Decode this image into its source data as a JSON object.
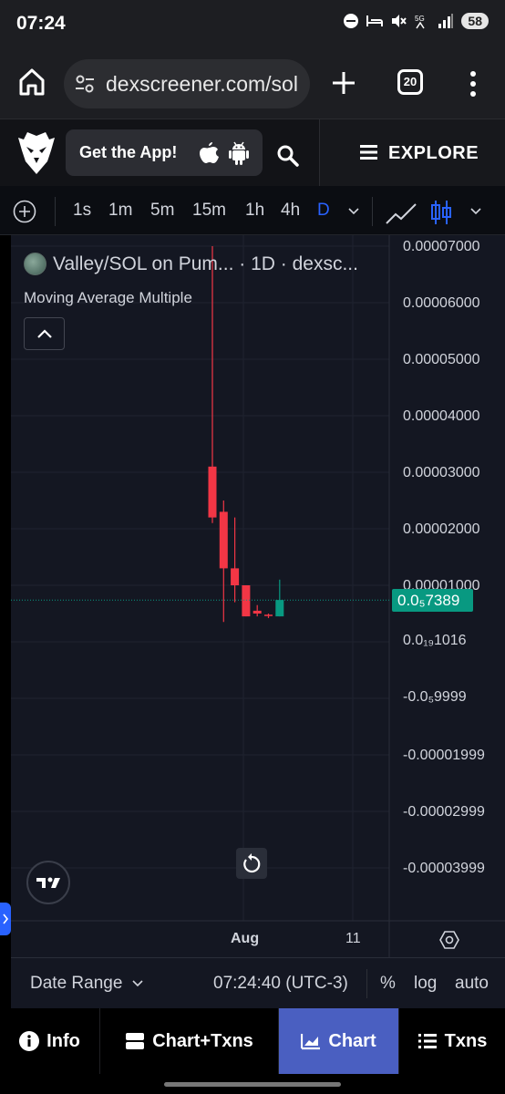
{
  "status": {
    "time": "07:24",
    "battery": "58"
  },
  "browser": {
    "url": "dexscreener.com/sol",
    "tab_count": "20"
  },
  "header": {
    "get_app_label": "Get the App!",
    "explore_label": "EXPLORE"
  },
  "toolbar": {
    "intervals": [
      {
        "label": "1s"
      },
      {
        "label": "1m"
      },
      {
        "label": "5m"
      },
      {
        "label": "15m"
      },
      {
        "label": "1h"
      },
      {
        "label": "4h"
      },
      {
        "label": "D"
      }
    ],
    "active_interval": "D"
  },
  "chart": {
    "legend_title": "Valley/SOL on Pum... · 1D · dexsc...",
    "indicator": "Moving Average Multiple",
    "y_labels": [
      "0.00007000",
      "0.00006000",
      "0.00005000",
      "0.00004000",
      "0.00003000",
      "0.00002000",
      "0.00001000",
      "0.0₁₉1016",
      "-0.0₅9999",
      "-0.00001999",
      "-0.00002999",
      "-0.00003999"
    ],
    "x_labels": [
      "Aug",
      "11"
    ],
    "current_price": "0.0₅7389"
  },
  "chart_data": {
    "type": "candlestick",
    "interval": "1D",
    "ylim": [
      -4e-05,
      7e-05
    ],
    "last_price": 7.389e-06,
    "candles": [
      {
        "open": 3.1e-05,
        "close": 2.2e-05,
        "high": 7e-05,
        "low": 2.1e-05
      },
      {
        "open": 2.3e-05,
        "close": 1.3e-05,
        "high": 2.5e-05,
        "low": 3.5e-06
      },
      {
        "open": 1.3e-05,
        "close": 1e-05,
        "high": 2.2e-05,
        "low": 7e-06
      },
      {
        "open": 1e-05,
        "close": 4.5e-06,
        "high": 1e-05,
        "low": 4.5e-06
      },
      {
        "open": 5.5e-06,
        "close": 5e-06,
        "high": 6.5e-06,
        "low": 4.5e-06
      },
      {
        "open": 4.8e-06,
        "close": 4.7e-06,
        "high": 5e-06,
        "low": 4.2e-06
      },
      {
        "open": 4.5e-06,
        "close": 7.4e-06,
        "high": 1.1e-05,
        "low": 4.5e-06
      }
    ]
  },
  "date_range": {
    "label": "Date Range",
    "time": "07:24:40 (UTC-3)",
    "options": [
      "%",
      "log",
      "auto"
    ]
  },
  "bottom_tabs": [
    {
      "label": "Info"
    },
    {
      "label": "Chart+Txns"
    },
    {
      "label": "Chart"
    },
    {
      "label": "Txns"
    }
  ],
  "colors": {
    "up": "#089981",
    "down": "#f23645",
    "accent": "#2962ff",
    "active_tab": "#4a5fc1"
  }
}
